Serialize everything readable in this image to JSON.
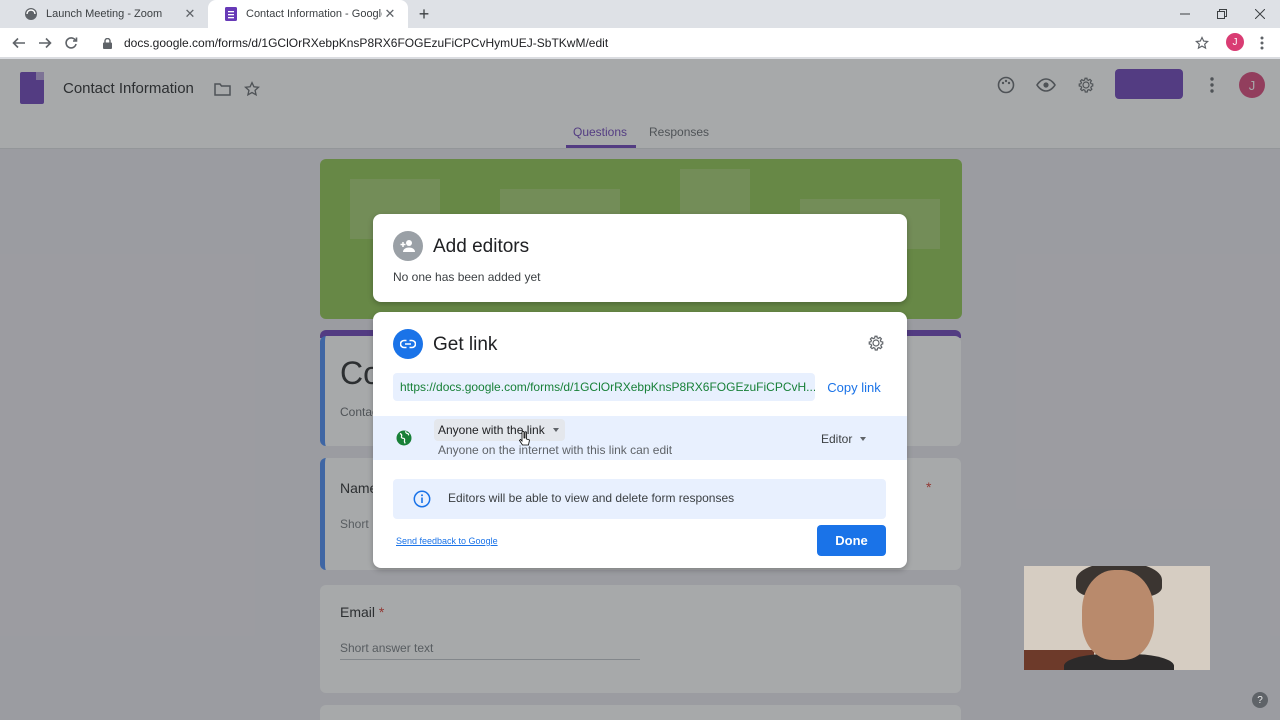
{
  "browser": {
    "tabs": [
      {
        "title": "Launch Meeting - Zoom",
        "favicon": "zoom-icon",
        "active": false
      },
      {
        "title": "Contact Information - Google Fo",
        "favicon": "google-forms-icon",
        "active": true
      }
    ],
    "new_tab_glyph": "+",
    "url": "docs.google.com/forms/d/1GClOrRXebpKnsP8RX6FOGEzuFiCPCvHymUEJ-SbTKwM/edit",
    "profile_initial": "J",
    "window_controls": [
      "minimize",
      "restore",
      "close"
    ]
  },
  "forms_header": {
    "doc_title": "Contact Information",
    "account_initial": "J",
    "tabs": [
      {
        "label": "Questions",
        "selected": true
      },
      {
        "label": "Responses",
        "selected": false
      }
    ]
  },
  "form": {
    "title_visible": "Co",
    "description_visible": "Contac",
    "questions": [
      {
        "label": "Name",
        "hint": "Short"
      },
      {
        "label": "Email",
        "required_mark": "*",
        "hint": "Short answer text"
      }
    ],
    "required_mark": "*"
  },
  "share_dialog": {
    "editors": {
      "title": "Add editors",
      "subtitle": "No one has been added yet"
    },
    "link": {
      "title": "Get link",
      "url_text": "https://docs.google.com/forms/d/1GClOrRXebpKnsP8RX6FOGEzuFiCPCvH...",
      "copy_label": "Copy link",
      "access_label": "Anyone with the link",
      "access_description": "Anyone on the internet with this link can edit",
      "role_label": "Editor",
      "info_text": "Editors will be able to view and delete form responses",
      "feedback_label": "Send feedback to Google",
      "done_label": "Done"
    }
  },
  "help_glyph": "?",
  "colors": {
    "forms_purple": "#673ab7",
    "google_blue": "#1a73e8",
    "link_green": "#188038",
    "banner_green": "#8bc34a"
  }
}
